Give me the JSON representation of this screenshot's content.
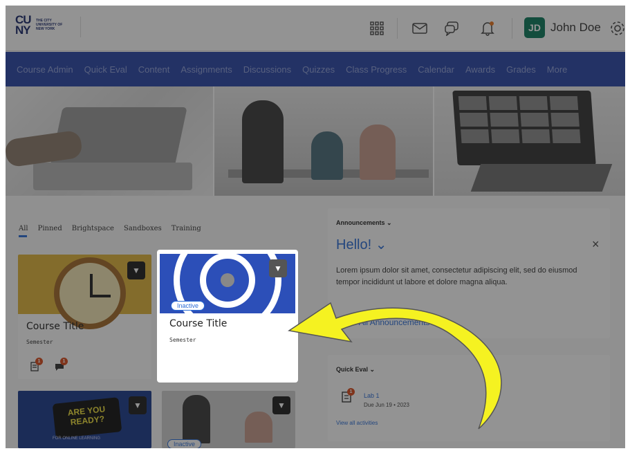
{
  "header": {
    "logo_mark": "CU NY",
    "logo_text": "THE CITY UNIVERSITY OF NEW YORK",
    "user_initials": "JD",
    "user_name": "John Doe",
    "icons": [
      "apps-grid-icon",
      "mail-icon",
      "chat-icon",
      "bell-icon",
      "settings-icon"
    ]
  },
  "nav": {
    "items": [
      "Course Admin",
      "Quick Eval",
      "Content",
      "Assignments",
      "Discussions",
      "Quizzes",
      "Class Progress",
      "Calendar",
      "Awards",
      "Grades",
      "More"
    ]
  },
  "tabs": [
    "All",
    "Pinned",
    "Brightspace",
    "Sandboxes",
    "Training"
  ],
  "cards": [
    {
      "title": "Course Title",
      "semester": "Semester",
      "badge_assign": "1",
      "badge_chat": "1"
    },
    {
      "title": "Course Title",
      "semester": "Semester",
      "status": "Inactive"
    },
    {
      "text": "ARE YOU READY?",
      "caption": "FOR ONLINE LEARNING"
    },
    {
      "status": "Inactive"
    }
  ],
  "announcements": {
    "title": "Announcements",
    "heading": "Hello!",
    "body": "Lorem ipsum dolor sit amet, consectetur adipiscing elit, sed do eiusmod tempor incididunt ut labore et dolore magna aliqua.",
    "link": "Show All Announcements",
    "close": "×"
  },
  "quick_eval": {
    "title": "Quick Eval",
    "item": "Lab 1",
    "due": "Due Jun 19 • 2023",
    "badge": "1",
    "link": "View all activities"
  },
  "colors": {
    "accent": "#2a6cd6",
    "nav": "#2a45a8",
    "highlight_arrow": "#f5f221"
  }
}
